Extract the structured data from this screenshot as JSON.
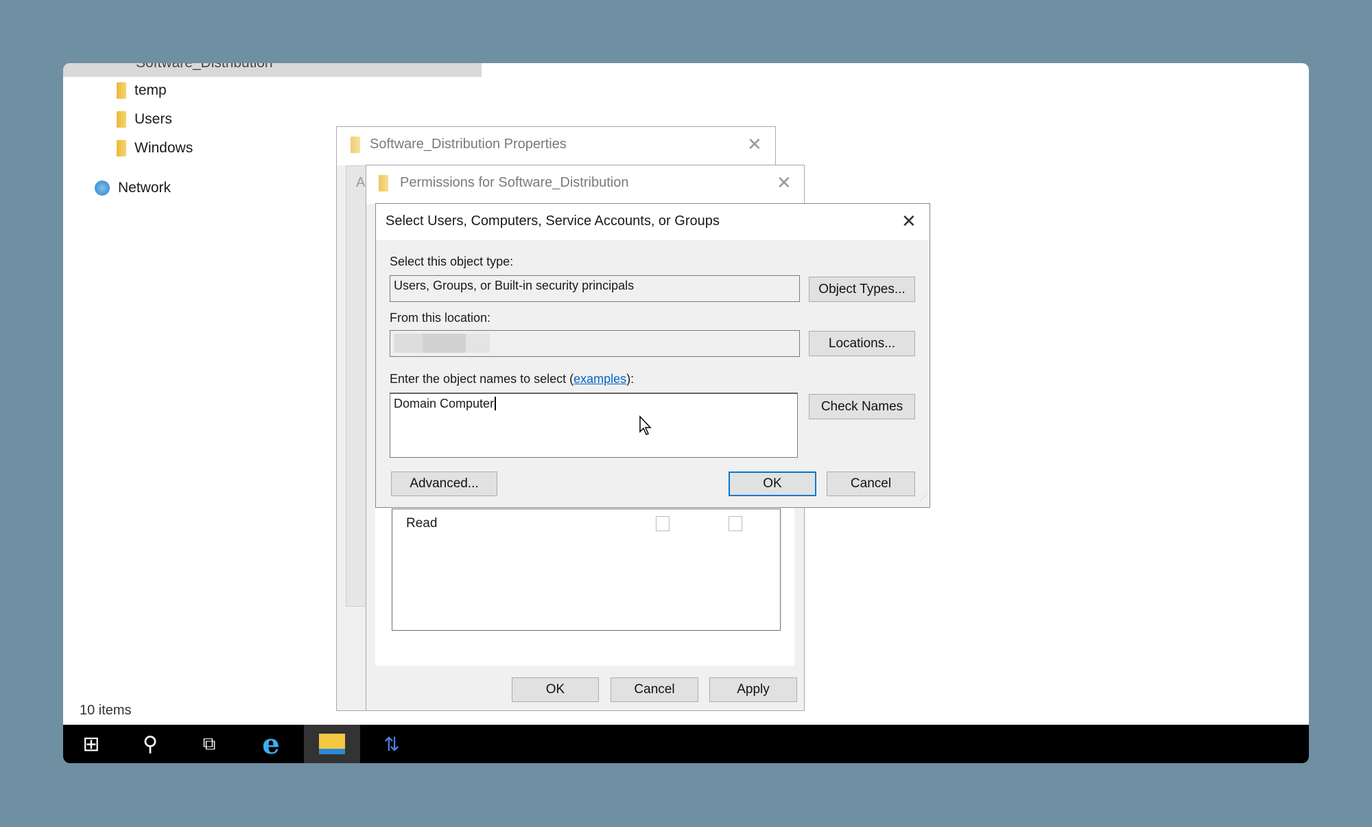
{
  "explorer": {
    "tree": [
      {
        "label": "Software_Distribution",
        "icon": "folder-icon"
      },
      {
        "label": "temp",
        "icon": "folder-icon"
      },
      {
        "label": "Users",
        "icon": "folder-icon"
      },
      {
        "label": "Windows",
        "icon": "folder-icon"
      },
      {
        "label": "Network",
        "icon": "network-icon"
      }
    ],
    "status": "10 items"
  },
  "properties_dialog": {
    "title": "Software_Distribution Properties",
    "tab_partial": "A",
    "buttons": {
      "ok": "OK",
      "cancel": "Cancel",
      "apply": "Apply"
    }
  },
  "permissions_dialog": {
    "title": "Permissions for Software_Distribution",
    "permission_rows": [
      {
        "label": "Read",
        "allow": false,
        "deny": false
      }
    ]
  },
  "select_dialog": {
    "title": "Select Users, Computers, Service Accounts, or Groups",
    "object_type_label": "Select this object type:",
    "object_type_value": "Users, Groups, or Built-in security principals",
    "object_types_button": "Object Types...",
    "location_label": "From this location:",
    "locations_button": "Locations...",
    "names_label_prefix": "Enter the object names to select (",
    "names_label_link": "examples",
    "names_label_suffix": "):",
    "names_value": "Domain Computer",
    "check_names_button": "Check Names",
    "advanced_button": "Advanced...",
    "ok_button": "OK",
    "cancel_button": "Cancel",
    "accent": "#0078d7"
  },
  "taskbar": {
    "items": [
      "windows-start-icon",
      "search-icon",
      "task-view-icon",
      "internet-explorer-icon",
      "file-explorer-icon",
      "network-connections-icon"
    ]
  }
}
